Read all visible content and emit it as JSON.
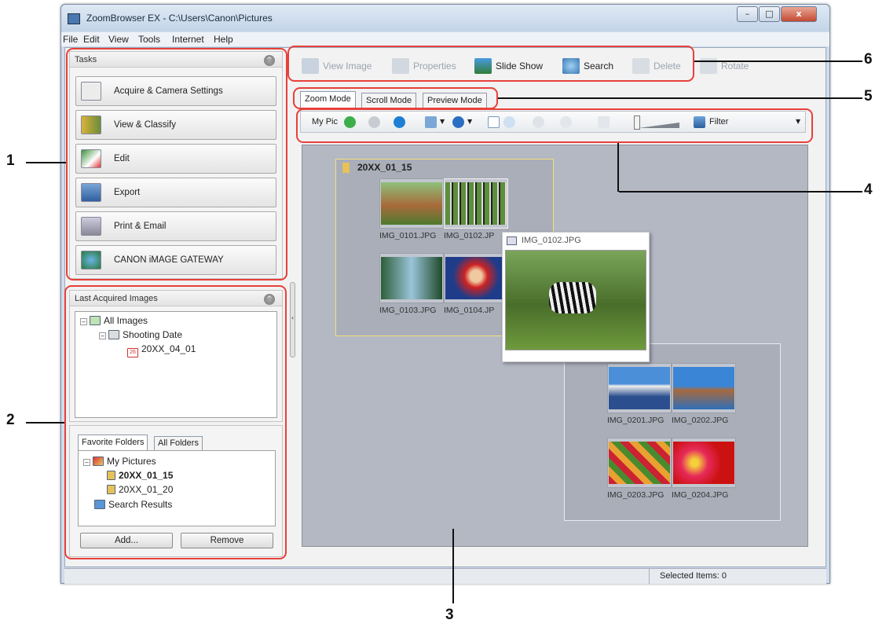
{
  "window": {
    "title": "ZoomBrowser EX  -  C:\\Users\\Canon\\Pictures",
    "controls": {
      "minimize": "–",
      "maximize": "□",
      "close": "x"
    }
  },
  "menu": [
    "File",
    "Edit",
    "View",
    "Tools",
    "Internet",
    "Help"
  ],
  "tasks": {
    "header": "Tasks",
    "items": [
      "Acquire & Camera Settings",
      "View & Classify",
      "Edit",
      "Export",
      "Print & Email",
      "CANON iMAGE GATEWAY"
    ]
  },
  "last_acquired": {
    "header": "Last Acquired Images",
    "tree": [
      "All Images",
      "Shooting Date",
      "20XX_04_01"
    ],
    "date_badge": "26"
  },
  "folders": {
    "tabs": [
      "Favorite Folders",
      "All Folders"
    ],
    "tree": [
      "My Pictures",
      "20XX_01_15",
      "20XX_01_20",
      "Search Results"
    ],
    "add_label": "Add...",
    "remove_label": "Remove"
  },
  "toolbar": [
    "View Image",
    "Properties",
    "Slide Show",
    "Search",
    "Delete",
    "Rotate"
  ],
  "mode_tabs": [
    "Zoom Mode",
    "Scroll Mode",
    "Preview Mode"
  ],
  "subbar": {
    "label": "My Pic",
    "filter_label": "Filter"
  },
  "view": {
    "group1": {
      "title": "20XX_01_15",
      "captions": [
        "IMG_0101.JPG",
        "IMG_0102.JP",
        "IMG_0103.JPG",
        "IMG_0104.JP"
      ]
    },
    "group2": {
      "captions": [
        "IMG_0201.JPG",
        "IMG_0202.JPG",
        "IMG_0203.JPG",
        "IMG_0204.JPG"
      ]
    },
    "preview": {
      "title": "IMG_0102.JPG"
    }
  },
  "status": {
    "text": "Selected Items: 0"
  },
  "callouts": [
    "1",
    "2",
    "3",
    "4",
    "5",
    "6"
  ],
  "colors": {
    "callout": "#e8403a",
    "selection": "#f2e27a"
  }
}
